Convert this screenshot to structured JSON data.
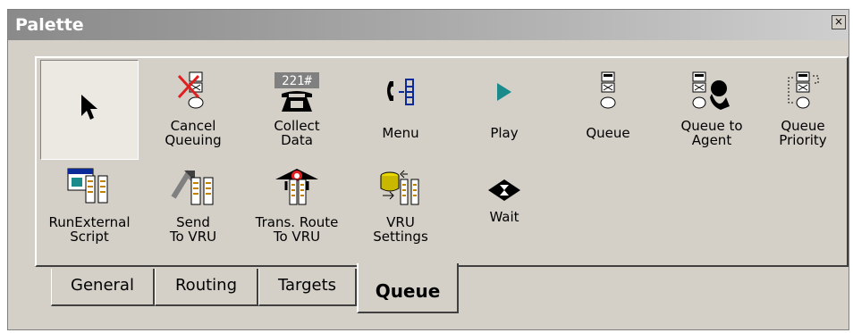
{
  "window": {
    "title": "Palette",
    "close_label": "×"
  },
  "tools": [
    {
      "id": "pointer",
      "label": "",
      "icon": "arrow-pointer-icon",
      "selected": true
    },
    {
      "id": "cancel-queuing",
      "label": "Cancel\nQueuing",
      "icon": "cancel-queuing-icon"
    },
    {
      "id": "collect-data",
      "label": "Collect\nData",
      "icon": "collect-data-icon",
      "keypad_text": "221#"
    },
    {
      "id": "menu",
      "label": "Menu",
      "icon": "menu-icon"
    },
    {
      "id": "play",
      "label": "Play",
      "icon": "play-icon"
    },
    {
      "id": "queue",
      "label": "Queue",
      "icon": "queue-icon"
    },
    {
      "id": "queue-to-agent",
      "label": "Queue to\nAgent",
      "icon": "queue-to-agent-icon"
    },
    {
      "id": "queue-priority",
      "label": "Queue\nPriority",
      "icon": "queue-priority-icon"
    },
    {
      "id": "run-external-script",
      "label": "RunExternal\nScript",
      "icon": "run-external-script-icon"
    },
    {
      "id": "send-to-vru",
      "label": "Send\nTo VRU",
      "icon": "send-to-vru-icon"
    },
    {
      "id": "trans-route-to-vru",
      "label": "Trans. Route\nTo VRU",
      "icon": "trans-route-to-vru-icon"
    },
    {
      "id": "vru-settings",
      "label": "VRU\nSettings",
      "icon": "vru-settings-icon"
    },
    {
      "id": "wait",
      "label": "Wait",
      "icon": "wait-icon"
    }
  ],
  "tabs": [
    {
      "label": "General",
      "active": false
    },
    {
      "label": "Routing",
      "active": false
    },
    {
      "label": "Targets",
      "active": false
    },
    {
      "label": "Queue",
      "active": true
    }
  ],
  "colors": {
    "face": "#d4d0c8",
    "play": "#1a8a8a",
    "menu_blue": "#0a2a9a",
    "cancel_red": "#e02020"
  }
}
